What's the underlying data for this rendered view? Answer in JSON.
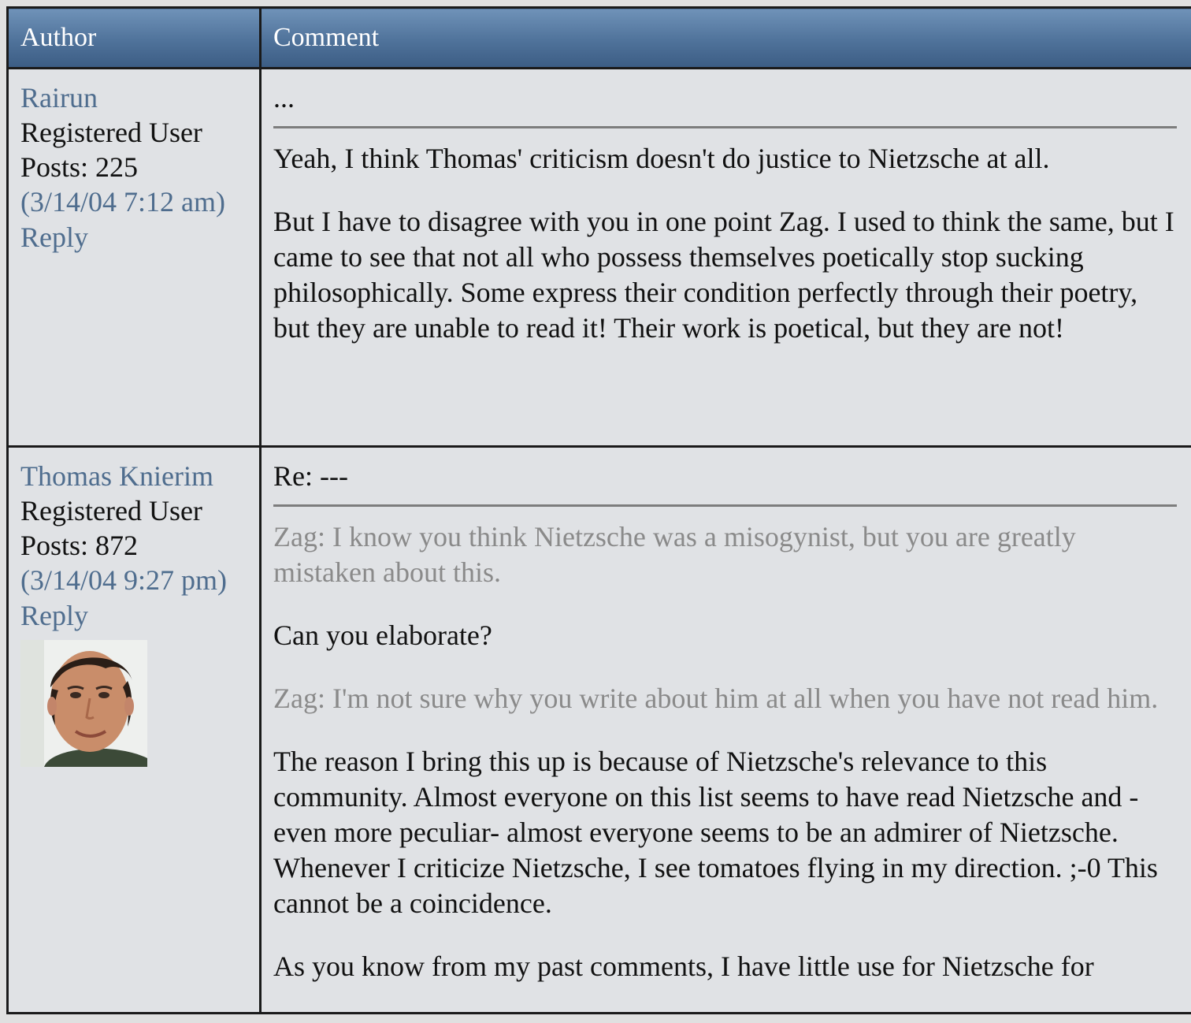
{
  "header": {
    "author": "Author",
    "comment": "Comment"
  },
  "posts": [
    {
      "author": "Rairun",
      "role": "Registered User",
      "posts": "Posts: 225",
      "timestamp": "(3/14/04 7:12 am)",
      "reply": "Reply",
      "subject": "...",
      "paragraphs": [
        "Yeah, I think Thomas' criticism doesn't do justice to Nietzsche at all.",
        "But I have to disagree with you in one point Zag. I used to think the same, but I came to see that not all who possess themselves poetically stop sucking philosophically. Some express their condition perfectly through their poetry, but they are unable to read it! Their work is poetical, but they are not!"
      ]
    },
    {
      "author": "Thomas Knierim",
      "role": "Registered User",
      "posts": "Posts: 872",
      "timestamp": "(3/14/04 9:27 pm)",
      "reply": "Reply",
      "avatar_alt": "avatar",
      "subject": "Re: ---",
      "paragraphs": [
        "Zag: I know you think Nietzsche was a misogynist, but you are greatly mistaken about this.",
        "Can you elaborate?",
        "Zag: I'm not sure why you write about him at all when you have not read him.",
        "The reason I bring this up is because of Nietzsche's relevance to this community. Almost everyone on this list seems to have read Nietzsche and -even more peculiar- almost everyone seems to be an admirer of Nietzsche. Whenever I criticize Nietzsche, I see tomatoes flying in my direction. ;-0 This cannot be a coincidence.",
        "As you know from my past comments, I have little use for Nietzsche for"
      ]
    }
  ],
  "colors": {
    "header_gradient_top": "#6f92b8",
    "header_gradient_bottom": "#3c5d84",
    "link": "#4f6d8e",
    "quote_text": "#8a8a8a",
    "cell_background": "#e0e2e5"
  }
}
